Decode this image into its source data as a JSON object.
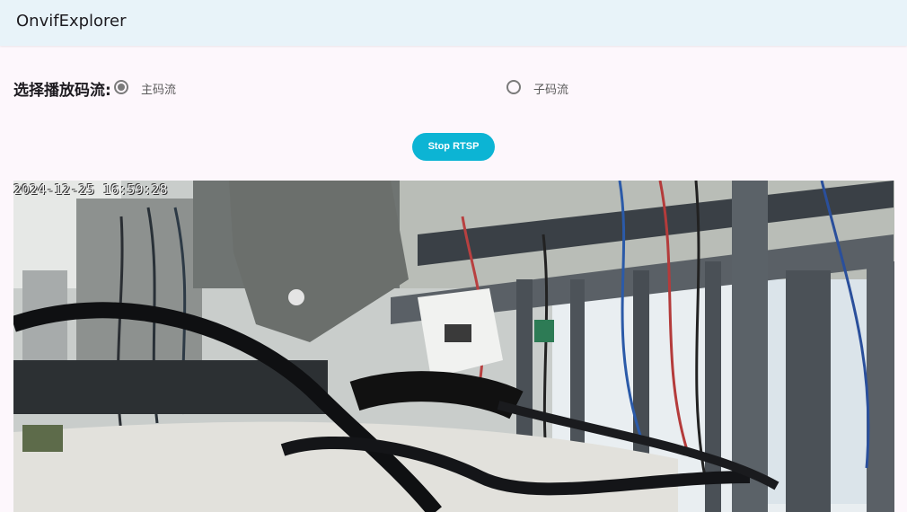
{
  "app": {
    "title": "OnvifExplorer"
  },
  "stream": {
    "label": "选择播放码流:",
    "options": [
      {
        "label": "主码流",
        "selected": true
      },
      {
        "label": "子码流",
        "selected": false
      }
    ]
  },
  "controls": {
    "stop_button": "Stop RTSP"
  },
  "video": {
    "timestamp": "2024-12-25 16:59:28"
  },
  "colors": {
    "accent": "#0cb4d4",
    "appbar": "#e8f3f9",
    "background": "#fdf7fc"
  }
}
